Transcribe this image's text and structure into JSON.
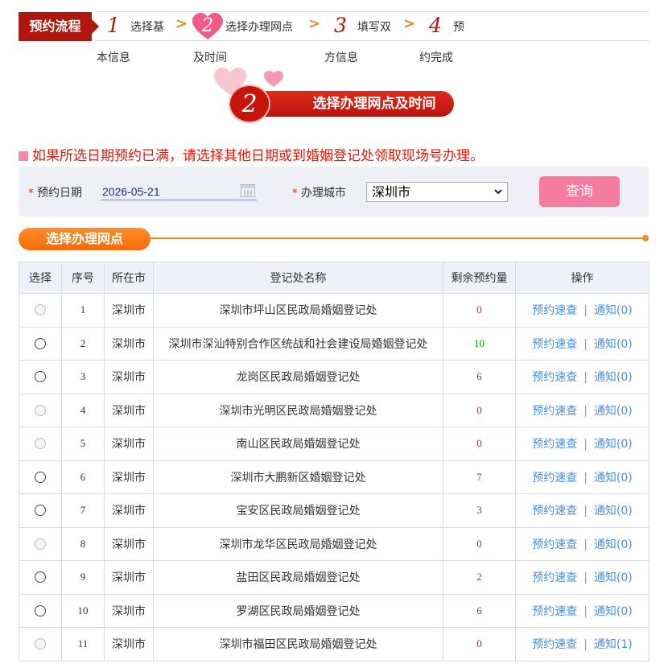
{
  "steps": {
    "flow_label": "预约流程",
    "items": [
      {
        "num": "1",
        "line1": "选择基",
        "line2": "本信息"
      },
      {
        "num": "2",
        "line1": "选择办理网点",
        "line2": "及时间"
      },
      {
        "num": "3",
        "line1": "填写双",
        "line2": "方信息"
      },
      {
        "num": "4",
        "line1": "预",
        "line2": "约完成"
      }
    ],
    "arrow": ">"
  },
  "banner": {
    "num": "2",
    "text": "选择办理网点及时间"
  },
  "notice": "如果所选日期预约已满，请选择其他日期或到婚姻登记处领取现场号办理。",
  "query": {
    "required_mark": "*",
    "date_label": "预约日期",
    "date_value": "2026-05-21",
    "city_label": "办理城市",
    "city_value": "深圳市",
    "button": "查询"
  },
  "section_title": "选择办理网点",
  "table": {
    "headers": [
      "选择",
      "序号",
      "所在市",
      "登记处名称",
      "剩余预约量",
      "操作"
    ],
    "op_labels": {
      "check": "预约速查",
      "sep": "|"
    },
    "rows": [
      {
        "enabled": false,
        "index": "1",
        "city": "深圳市",
        "name": "深圳市坪山区民政局婚姻登记处",
        "remain": "0",
        "notice": "通知(0)"
      },
      {
        "enabled": true,
        "index": "2",
        "city": "深圳市",
        "name": "深圳市深汕特别合作区统战和社会建设局婚姻登记处",
        "remain": "10",
        "notice": "通知(0)"
      },
      {
        "enabled": true,
        "index": "3",
        "city": "深圳市",
        "name": "龙岗区民政局婚姻登记处",
        "remain": "6",
        "notice": "通知(0)"
      },
      {
        "enabled": false,
        "index": "4",
        "city": "深圳市",
        "name": "深圳市光明区民政局婚姻登记处",
        "remain": "0",
        "notice": "通知(0)"
      },
      {
        "enabled": false,
        "index": "5",
        "city": "深圳市",
        "name": "南山区民政局婚姻登记处",
        "remain": "0",
        "notice": "通知(0)"
      },
      {
        "enabled": true,
        "index": "6",
        "city": "深圳市",
        "name": "深圳市大鹏新区婚姻登记处",
        "remain": "7",
        "notice": "通知(0)"
      },
      {
        "enabled": true,
        "index": "7",
        "city": "深圳市",
        "name": "宝安区民政局婚姻登记处",
        "remain": "3",
        "notice": "通知(0)"
      },
      {
        "enabled": false,
        "index": "8",
        "city": "深圳市",
        "name": "深圳市龙华区民政局婚姻登记处",
        "remain": "0",
        "notice": "通知(0)"
      },
      {
        "enabled": true,
        "index": "9",
        "city": "深圳市",
        "name": "盐田区民政局婚姻登记处",
        "remain": "2",
        "notice": "通知(0)"
      },
      {
        "enabled": true,
        "index": "10",
        "city": "深圳市",
        "name": "罗湖区民政局婚姻登记处",
        "remain": "6",
        "notice": "通知(0)"
      },
      {
        "enabled": false,
        "index": "11",
        "city": "深圳市",
        "name": "深圳市福田区民政局婚姻登记处",
        "remain": "0",
        "notice": "通知(1)"
      }
    ]
  },
  "colors": {
    "brand_red": "#b0160e",
    "notice_red": "#e8170c",
    "orange": "#f08a1e",
    "pink_button": "#f57ca0",
    "link_blue": "#4a8ee0",
    "available_green": "#1f7a1f"
  },
  "icons": {
    "heart": "heart-icon",
    "calendar": "calendar-icon",
    "dropdown": "chevron-down-icon",
    "radio": "radio-icon"
  }
}
